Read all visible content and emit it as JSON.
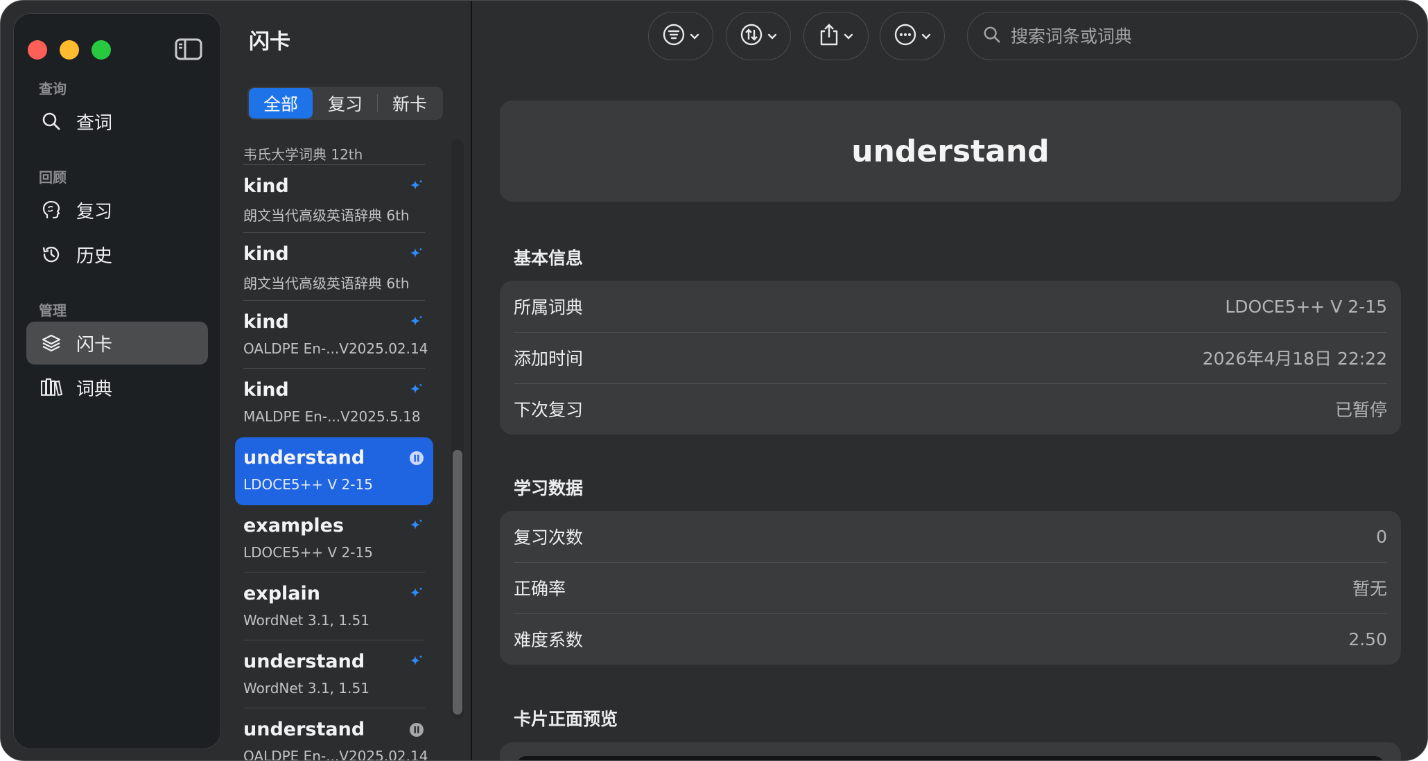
{
  "sidebar": {
    "sections": [
      {
        "label": "查询",
        "items": [
          {
            "label": "查词",
            "icon": "search-icon"
          }
        ]
      },
      {
        "label": "回顾",
        "items": [
          {
            "label": "复习",
            "icon": "brain-head-icon"
          },
          {
            "label": "历史",
            "icon": "history-clock-icon"
          }
        ]
      },
      {
        "label": "管理",
        "items": [
          {
            "label": "闪卡",
            "icon": "stack-layers-icon",
            "active": true
          },
          {
            "label": "词典",
            "icon": "books-icon"
          }
        ]
      }
    ]
  },
  "list": {
    "title": "闪卡",
    "segments": [
      "全部",
      "复习",
      "新卡"
    ],
    "selected_segment": "全部",
    "dict_header": "韦氏大学词典 12th",
    "cards": [
      {
        "word": "kind",
        "dict": "朗文当代高级英语辞典 6th",
        "status": "new"
      },
      {
        "word": "kind",
        "dict": "朗文当代高级英语辞典 6th",
        "status": "new"
      },
      {
        "word": "kind",
        "dict": "OALDPE En-...V2025.02.14",
        "status": "new"
      },
      {
        "word": "kind",
        "dict": "MALDPE En-...V2025.5.18",
        "status": "new"
      },
      {
        "word": "understand",
        "dict": "LDOCE5++ V 2-15",
        "status": "paused",
        "selected": true
      },
      {
        "word": "examples",
        "dict": "LDOCE5++ V 2-15",
        "status": "new"
      },
      {
        "word": "explain",
        "dict": "WordNet 3.1, 1.51",
        "status": "new"
      },
      {
        "word": "understand",
        "dict": "WordNet 3.1, 1.51",
        "status": "new"
      },
      {
        "word": "understand",
        "dict": "OALDPE En-...V2025.02.14",
        "status": "paused"
      }
    ]
  },
  "toolbar": {
    "buttons": [
      {
        "name": "filter",
        "icon": "filter-lines-icon"
      },
      {
        "name": "sort",
        "icon": "sort-arrows-icon"
      },
      {
        "name": "share",
        "icon": "share-icon"
      },
      {
        "name": "more",
        "icon": "ellipsis-icon"
      }
    ],
    "search_placeholder": "搜索词条或词典"
  },
  "detail": {
    "word": "understand",
    "basic_title": "基本信息",
    "basic": [
      {
        "key": "所属词典",
        "value": "LDOCE5++ V 2-15"
      },
      {
        "key": "添加时间",
        "value": "2026年4月18日 22:22"
      },
      {
        "key": "下次复习",
        "value": "已暂停"
      }
    ],
    "stats_title": "学习数据",
    "stats": [
      {
        "key": "复习次数",
        "value": "0"
      },
      {
        "key": "正确率",
        "value": "暂无"
      },
      {
        "key": "难度系数",
        "value": "2.50"
      }
    ],
    "preview_title": "卡片正面预览"
  },
  "colors": {
    "accent": "#1e73e8",
    "sparkle": "#2f8cff",
    "window_bg": "#2b2d2e",
    "sidebar_bg": "#1d2022"
  }
}
